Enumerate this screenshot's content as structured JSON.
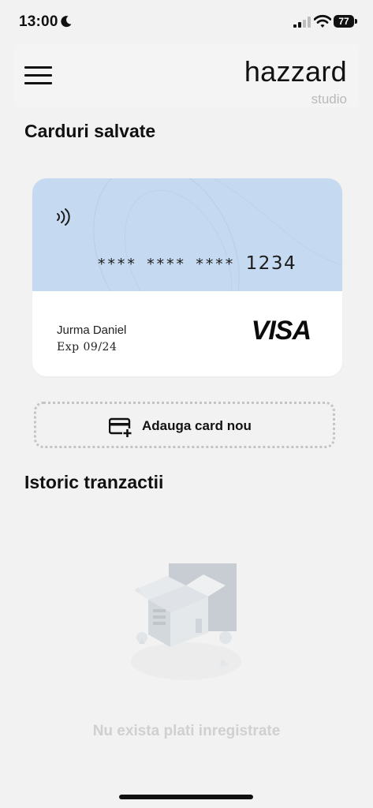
{
  "status_bar": {
    "time": "13:00",
    "battery": "77"
  },
  "header": {
    "brand_name": "hazzard",
    "brand_sub": "studio"
  },
  "saved_cards": {
    "title": "Carduri salvate",
    "card": {
      "masked_number": "**** **** ****",
      "last4": "1234",
      "holder": "Jurma Daniel",
      "expiry": "Exp 09/24",
      "network": "VISA",
      "color": "#c5daf0"
    },
    "add_card_label": "Adauga card nou"
  },
  "transactions": {
    "title": "Istoric tranzactii",
    "empty_text": "Nu exista plati inregistrate"
  },
  "icons": [
    "moon-icon",
    "signal-icon",
    "wifi-icon",
    "battery-icon",
    "menu-icon",
    "nfc-icon",
    "add-card-icon",
    "empty-box-illustration"
  ]
}
